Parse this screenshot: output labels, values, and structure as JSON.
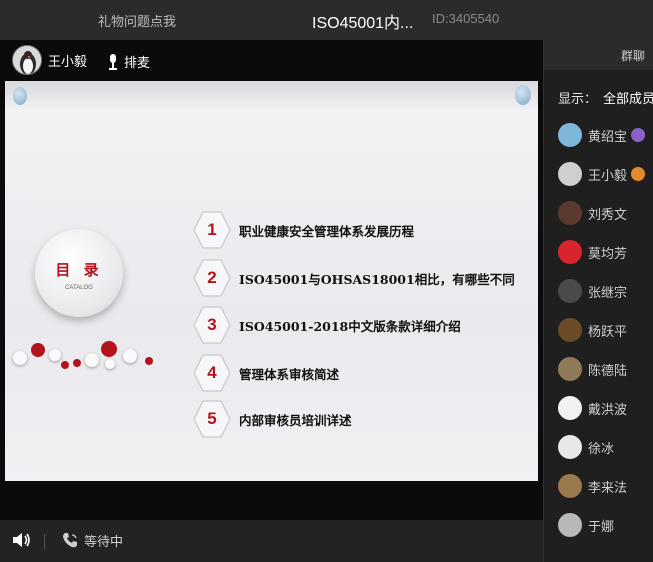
{
  "header": {
    "gift_text": "礼物问题点我",
    "room_title": "ISO45001内...",
    "room_id": "ID:3405540"
  },
  "presenter": {
    "name": "王小毅",
    "mic_label": "排麦"
  },
  "slide": {
    "catalog_title": "目 录",
    "catalog_subtitle": "CATALOG",
    "items": [
      {
        "num": "1",
        "label": "职业健康安全管理体系发展历程"
      },
      {
        "num": "2",
        "label": "ISO45001与OHSAS18001相比，有哪些不同"
      },
      {
        "num": "3",
        "label": "ISO45001-2018中文版条款详细介绍"
      },
      {
        "num": "4",
        "label": "管理体系审核简述"
      },
      {
        "num": "5",
        "label": "内部审核员培训详述"
      }
    ]
  },
  "bottom": {
    "call_status": "等待中"
  },
  "sidebar": {
    "title": "群聊",
    "display_label": "显示：",
    "display_value": "全部成员",
    "members": [
      {
        "name": "黄绍宝",
        "avatar_color": "#7fb7d9",
        "role_color": "#8a63c9"
      },
      {
        "name": "王小毅",
        "avatar_color": "#cfcfcf",
        "role_color": "#e38a2a"
      },
      {
        "name": "刘秀文",
        "avatar_color": "#5a3a2e"
      },
      {
        "name": "莫均芳",
        "avatar_color": "#d8242a"
      },
      {
        "name": "张继宗",
        "avatar_color": "#4a4a4a"
      },
      {
        "name": "杨跃平",
        "avatar_color": "#6b4a28"
      },
      {
        "name": "陈德陆",
        "avatar_color": "#8e7a58"
      },
      {
        "name": "戴洪波",
        "avatar_color": "#f2f2f2"
      },
      {
        "name": "徐冰",
        "avatar_color": "#e8e8e8"
      },
      {
        "name": "李来法",
        "avatar_color": "#9a7a4c"
      },
      {
        "name": "于娜",
        "avatar_color": "#b8b8b8"
      }
    ]
  },
  "colors": {
    "accent_red": "#b3131c",
    "titlebar_bg": "#2b2b2b",
    "stage_bg": "#0b0b0b"
  }
}
